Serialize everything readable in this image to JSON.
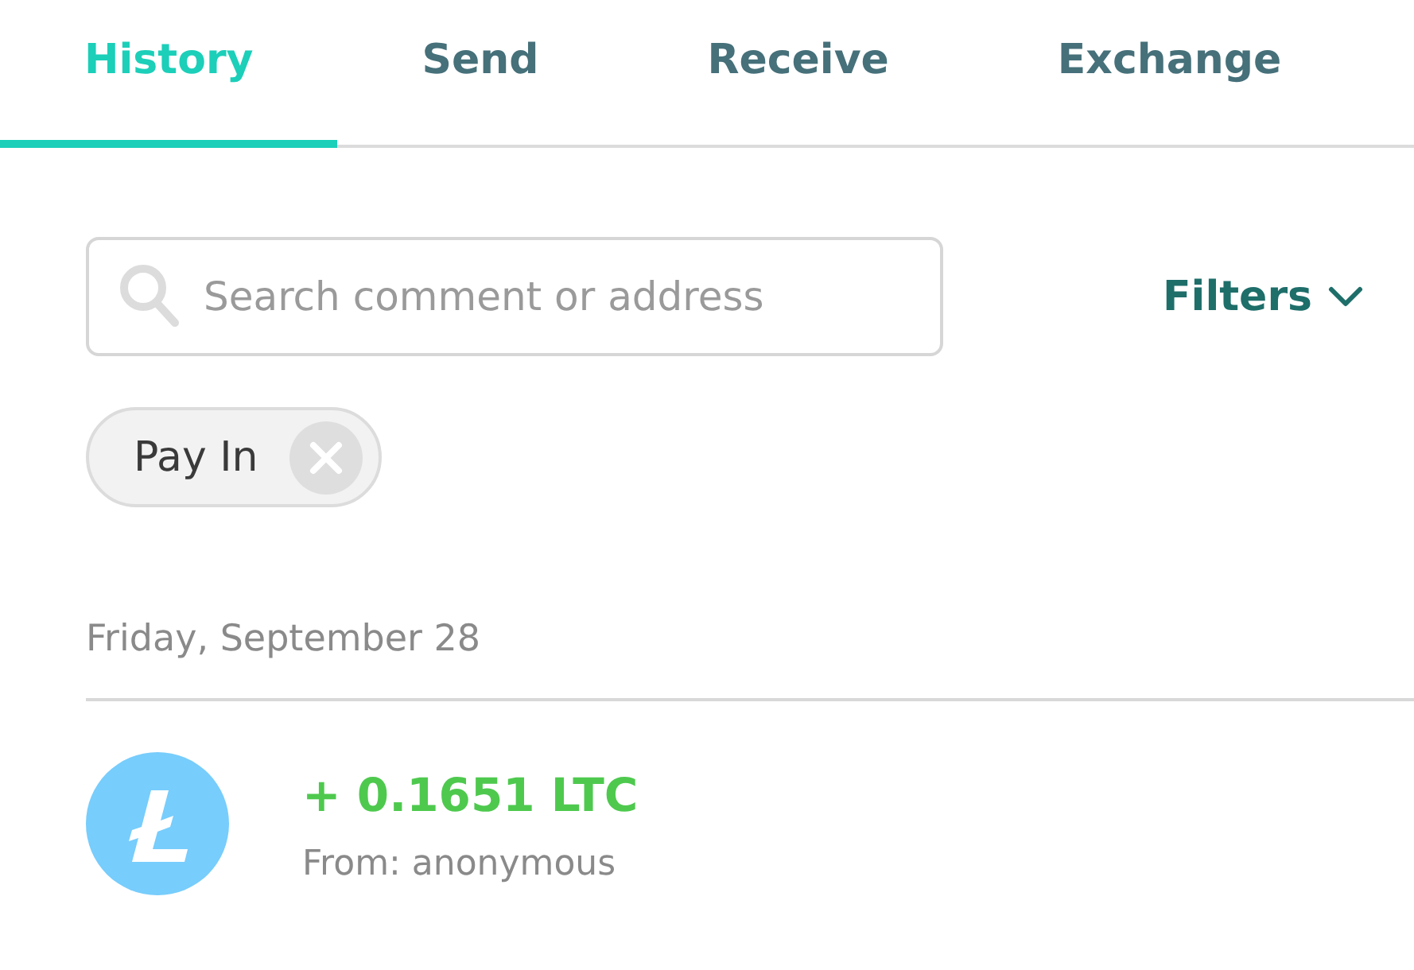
{
  "tabs": [
    {
      "label": "History",
      "selected": true
    },
    {
      "label": "Send",
      "selected": false
    },
    {
      "label": "Receive",
      "selected": false
    },
    {
      "label": "Exchange",
      "selected": false
    }
  ],
  "search": {
    "placeholder": "Search comment or address"
  },
  "filters_button": {
    "label": "Filters"
  },
  "active_filters": [
    {
      "label": "Pay In"
    }
  ],
  "history": [
    {
      "date": "Friday, September 28",
      "transactions": [
        {
          "kind": "incoming",
          "amount": "+ 0.1651 LTC",
          "counterparty": "From: anonymous"
        }
      ]
    }
  ]
}
